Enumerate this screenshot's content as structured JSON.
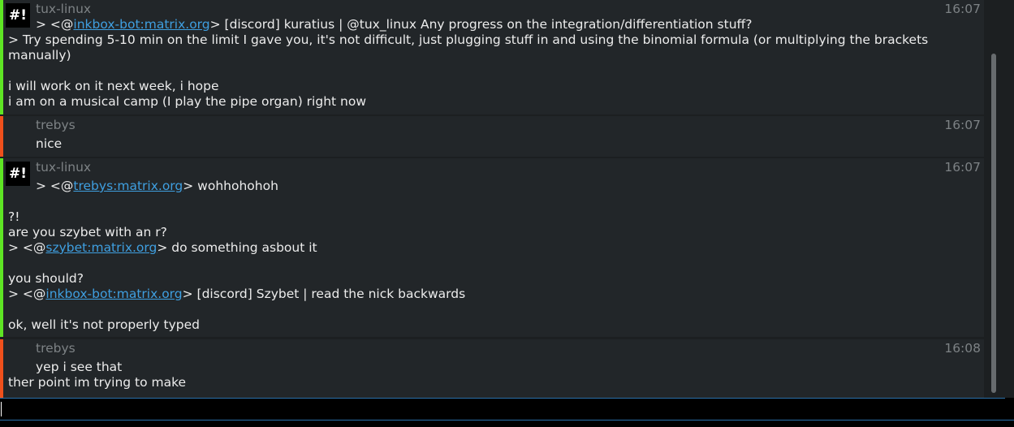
{
  "colors": {
    "tux_bar": "#5ee524",
    "trebys_bar": "#f0501c",
    "link": "#3f9fe0",
    "muted": "#7d8285"
  },
  "messages": [
    {
      "author": "tux-linux",
      "time": "16:07",
      "avatar": "#!",
      "lines": [
        [
          "> <@",
          {
            "link": "inkbox-bot:matrix.org"
          },
          "> [discord] kuratius | @tux_linux Any progress on the integration/differentiation stuff?"
        ],
        [
          "> Try spending 5-10 min on the limit I gave you, it's not difficult, just plugging stuff in and using the binomial formula (or multiplying the brackets"
        ],
        [
          "manually)"
        ],
        [
          "i will work on it next week, i hope"
        ],
        [
          "i am on a musical camp (I play the pipe organ) right now"
        ]
      ]
    },
    {
      "author": "trebys",
      "time": "16:07",
      "lines": [
        [
          "nice"
        ]
      ]
    },
    {
      "author": "tux-linux",
      "time": "16:07",
      "avatar": "#!",
      "lines": [
        [
          "> <@",
          {
            "link": "trebys:matrix.org"
          },
          "> wohhohohoh"
        ],
        [
          "?!"
        ],
        [
          "are you szybet with an r?"
        ],
        [
          "> <@",
          {
            "link": "szybet:matrix.org"
          },
          "> do something asbout it"
        ],
        [
          "you should?"
        ],
        [
          "> <@",
          {
            "link": "inkbox-bot:matrix.org"
          },
          "> [discord] Szybet | read the nick backwards"
        ],
        [
          "ok, well it's not properly typed"
        ]
      ]
    },
    {
      "author": "trebys",
      "time": "16:08",
      "lines": [
        [
          "yep i see that"
        ],
        [
          "ther point im trying to make"
        ]
      ]
    }
  ],
  "input": {
    "value": ""
  }
}
